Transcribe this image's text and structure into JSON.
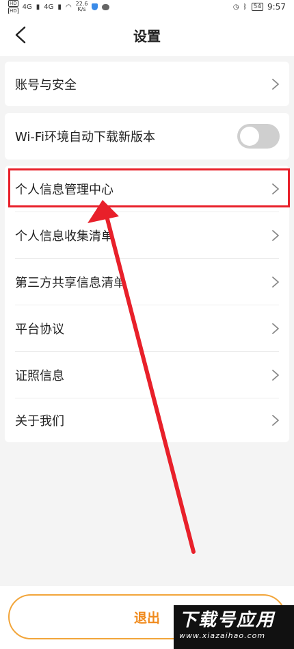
{
  "status_bar": {
    "tag_top": "HD",
    "tag_bottom": "HD",
    "signal1": "4G",
    "signal2": "4G",
    "speed_value": "22.6",
    "speed_unit": "K/s",
    "battery": "54",
    "time": "9:57"
  },
  "header": {
    "title": "设置"
  },
  "menu": {
    "account_security": "账号与安全",
    "wifi_auto_download": "Wi-Fi环境自动下载新版本",
    "wifi_toggle_on": false,
    "personal_info_center": "个人信息管理中心",
    "personal_info_collection": "个人信息收集清单",
    "third_party_sharing": "第三方共享信息清单",
    "platform_agreement": "平台协议",
    "license_info": "证照信息",
    "about_us": "关于我们"
  },
  "footer": {
    "logout_label": "退出"
  },
  "watermark": {
    "main": "下载号应用",
    "sub": "www.xiazaihao.com"
  },
  "colors": {
    "accent": "#f08a1c",
    "highlight": "#e8202a",
    "toggle_off": "#cfcfcf"
  }
}
